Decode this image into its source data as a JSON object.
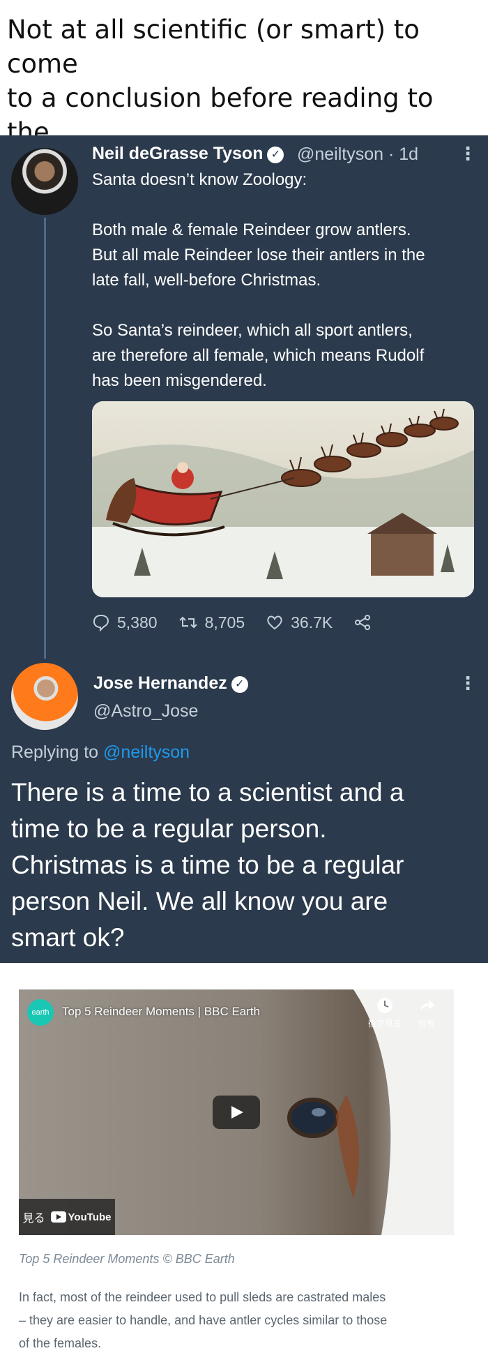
{
  "caption": "Not at all scientific (or smart) to come\nto a conclusion before reading to the\nend of the article...",
  "tweet": {
    "author_name": "Neil deGrasse Tyson",
    "handle_time": "@neiltyson · 1d",
    "text": "Santa doesn’t know Zoology:\n\nBoth male & female Reindeer grow antlers.\nBut all male Reindeer lose their antlers in the\nlate fall, well-before Christmas.\n\nSo Santa’s reindeer, which all sport antlers,\nare therefore all female, which means Rudolf\nhas been misgendered.",
    "image_icon": "santa-sleigh-illustration",
    "replies": "5,380",
    "retweets": "8,705",
    "likes": "36.7K"
  },
  "reply": {
    "author_name": "Jose Hernandez",
    "handle": "@Astro_Jose",
    "replying_prefix": "Replying to",
    "replying_to": "@neiltyson",
    "text": "There is a time to a scientist and a\ntime to be a regular person.\nChristmas is a time to be a regular\nperson Neil. We all know you are\nsmart ok?"
  },
  "video": {
    "channel_badge": "BBC\nearth",
    "title": "Top 5 Reindeer Moments | BBC Earth",
    "watch_later": "後で見る",
    "share": "共有",
    "watch_on": "見る",
    "youtube": "YouTube"
  },
  "video_caption": "Top 5 Reindeer Moments © BBC Earth",
  "article_text": "In fact, most of the reindeer used to pull sleds are castrated males\n– they are easier to handle, and have antler cycles similar to those\nof the females.",
  "colors": {
    "panel_bg": "#2b3a4c",
    "link": "#1d9bf0",
    "bbc_teal": "#19c7b4"
  }
}
